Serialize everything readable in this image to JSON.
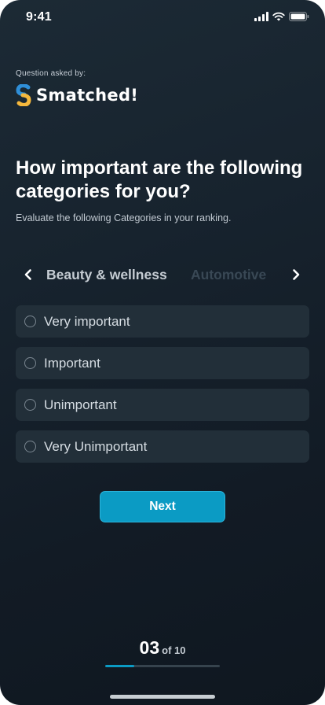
{
  "status_bar": {
    "time": "9:41",
    "icons": [
      "cellular-signal-icon",
      "wifi-icon",
      "battery-icon"
    ]
  },
  "brand": {
    "asked_by_label": "Question asked by:",
    "name": "Smatched!",
    "logo_colors": [
      "#2f8fd8",
      "#f5b83d"
    ]
  },
  "question": {
    "title": "How important are the following categories for you?",
    "subtitle": "Evaluate the following Categories in your ranking."
  },
  "carousel": {
    "active_category": "Beauty & wellness",
    "next_category": "Automotive",
    "prev_icon": "chevron-left-icon",
    "next_icon": "chevron-right-icon"
  },
  "options": [
    {
      "label": "Very important",
      "selected": false
    },
    {
      "label": "Important",
      "selected": false
    },
    {
      "label": "Unimportant",
      "selected": false
    },
    {
      "label": "Very Unimportant",
      "selected": false
    }
  ],
  "actions": {
    "next_label": "Next"
  },
  "progress": {
    "current": "03",
    "total_label": "of 10",
    "fraction": 0.25
  },
  "colors": {
    "accent": "#0b9bc4",
    "option_bg": "#222f39",
    "background": "#17232e"
  }
}
